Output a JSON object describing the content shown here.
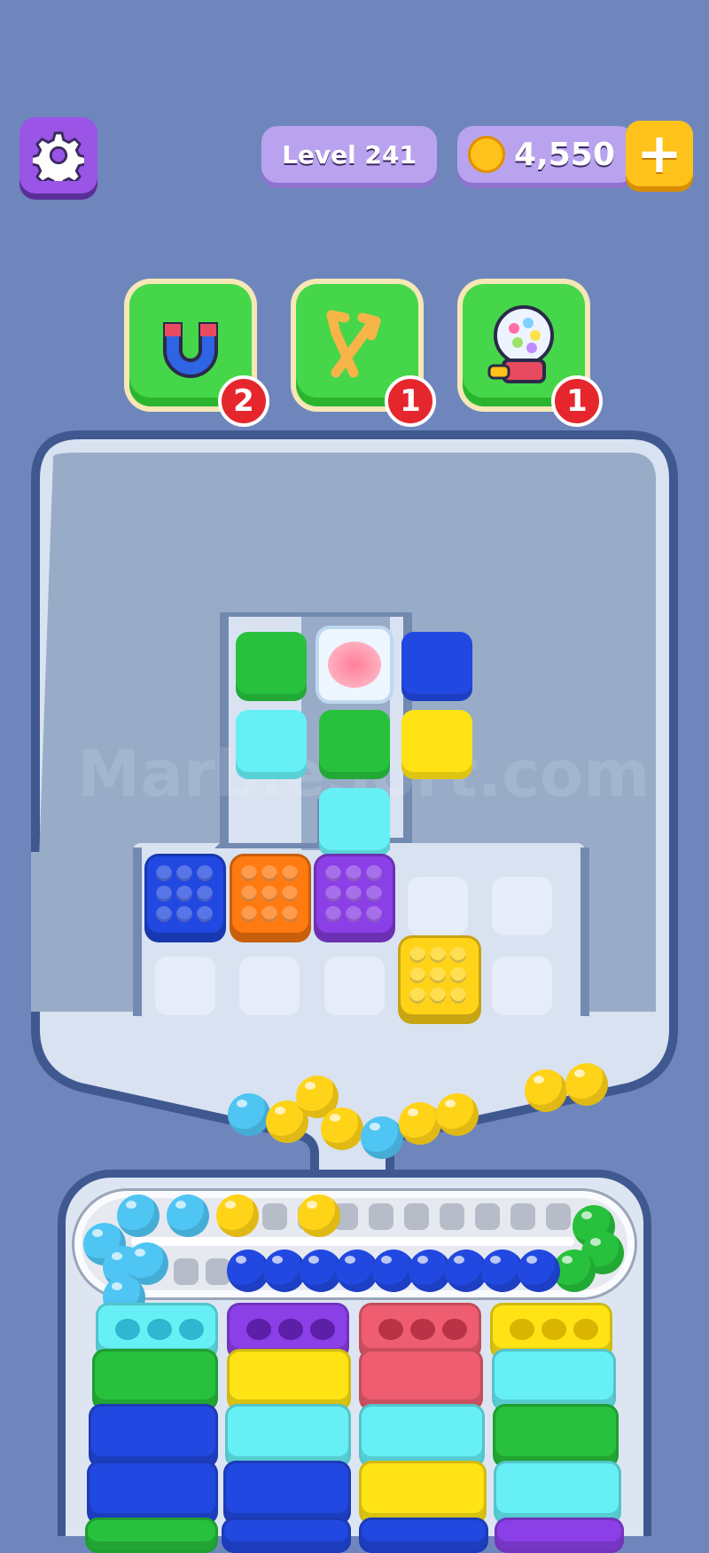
{
  "header": {
    "level_label": "Level 241",
    "coins": "4,550",
    "add_label": "+"
  },
  "boosters": [
    {
      "name": "magnet",
      "count": "2"
    },
    {
      "name": "swap",
      "count": "1"
    },
    {
      "name": "gumball-machine",
      "count": "1"
    }
  ],
  "watermark": "MarbleSort.com",
  "colors": {
    "background": "#6f86bd",
    "board": "#98acc8",
    "green": "#27c13d",
    "blue": "#2148e0",
    "cyan": "#66f0f6",
    "yellow": "#ffe314",
    "orange": "#ff7a10",
    "purple": "#8b3fe6",
    "red": "#ee5e70",
    "ball_yellow": "#ffd318",
    "ball_cyan": "#4fc5f3"
  }
}
